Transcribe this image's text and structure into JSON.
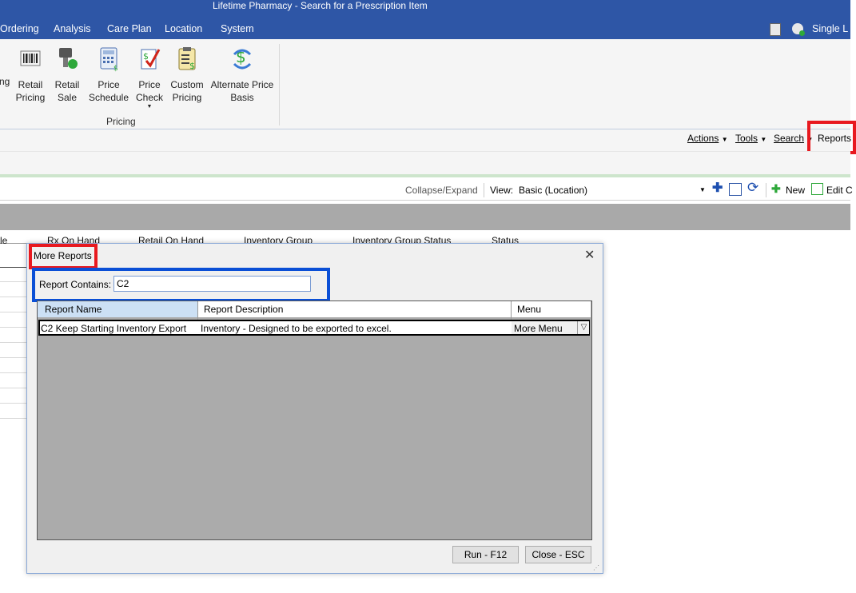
{
  "window": {
    "title": "Lifetime Pharmacy - Search for a Prescription Item"
  },
  "menu": {
    "items": [
      "Ordering",
      "Analysis",
      "Care Plan",
      "Location",
      "System"
    ],
    "right_label": "Single L"
  },
  "ribbon": {
    "left_cut_label": "ng",
    "buttons": [
      {
        "line1": "Retail",
        "line2": "Pricing",
        "icon": "barcode-icon"
      },
      {
        "line1": "Retail",
        "line2": "Sale",
        "icon": "scanner-sale-icon"
      },
      {
        "line1": "Price",
        "line2": "Schedule",
        "icon": "calculator-icon"
      },
      {
        "line1": "Price",
        "line2": "Check",
        "icon": "price-check-icon"
      },
      {
        "line1": "Custom",
        "line2": "Pricing",
        "icon": "clipboard-dollar-icon"
      },
      {
        "line1": "Alternate Price",
        "line2": "Basis",
        "icon": "dollar-refresh-icon"
      }
    ],
    "group_label": "Pricing"
  },
  "actions": {
    "actions_label": "Actions",
    "tools_label": "Tools",
    "search_label": "Search",
    "reports_label": "Reports"
  },
  "toolbar": {
    "collapse_label": "Collapse/Expand",
    "view_label": "View:",
    "view_value": "Basic (Location)",
    "new_label": "New",
    "edit_label": "Edit C"
  },
  "grid": {
    "columns": [
      "le",
      "Rx On Hand",
      "Retail On Hand",
      "Inventory Group",
      "Inventory Group Status",
      "Status"
    ]
  },
  "dialog": {
    "title": "More Reports",
    "close_glyph": "✕",
    "filter_label": "Report Contains:",
    "filter_value": "C2",
    "columns": {
      "name": "Report Name",
      "description": "Report Description",
      "menu": "Menu"
    },
    "rows": [
      {
        "name": "C2 Keep Starting Inventory Export",
        "description": "Inventory - Designed to be exported to excel.",
        "menu": "More Menu"
      }
    ],
    "run_button": "Run - F12",
    "close_button": "Close - ESC"
  },
  "colors": {
    "title_bar": "#2e56a6",
    "highlight_red": "#e8191f",
    "highlight_blue": "#0a4fd6"
  }
}
